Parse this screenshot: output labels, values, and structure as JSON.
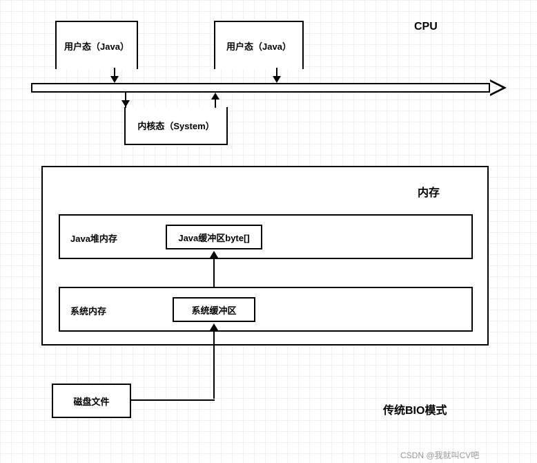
{
  "cpu": {
    "label": "CPU",
    "user_state_1": "用户态（Java）",
    "user_state_2": "用户态（Java）",
    "kernel_state": "内核态（System）"
  },
  "memory": {
    "label": "内存",
    "java_heap": {
      "label": "Java堆内存",
      "buffer": "Java缓冲区byte[]"
    },
    "system_mem": {
      "label": "系统内存",
      "buffer": "系统缓冲区"
    }
  },
  "disk": {
    "label": "磁盘文件"
  },
  "mode_label": "传统BIO模式",
  "watermark": "CSDN @我就叫CV吧"
}
